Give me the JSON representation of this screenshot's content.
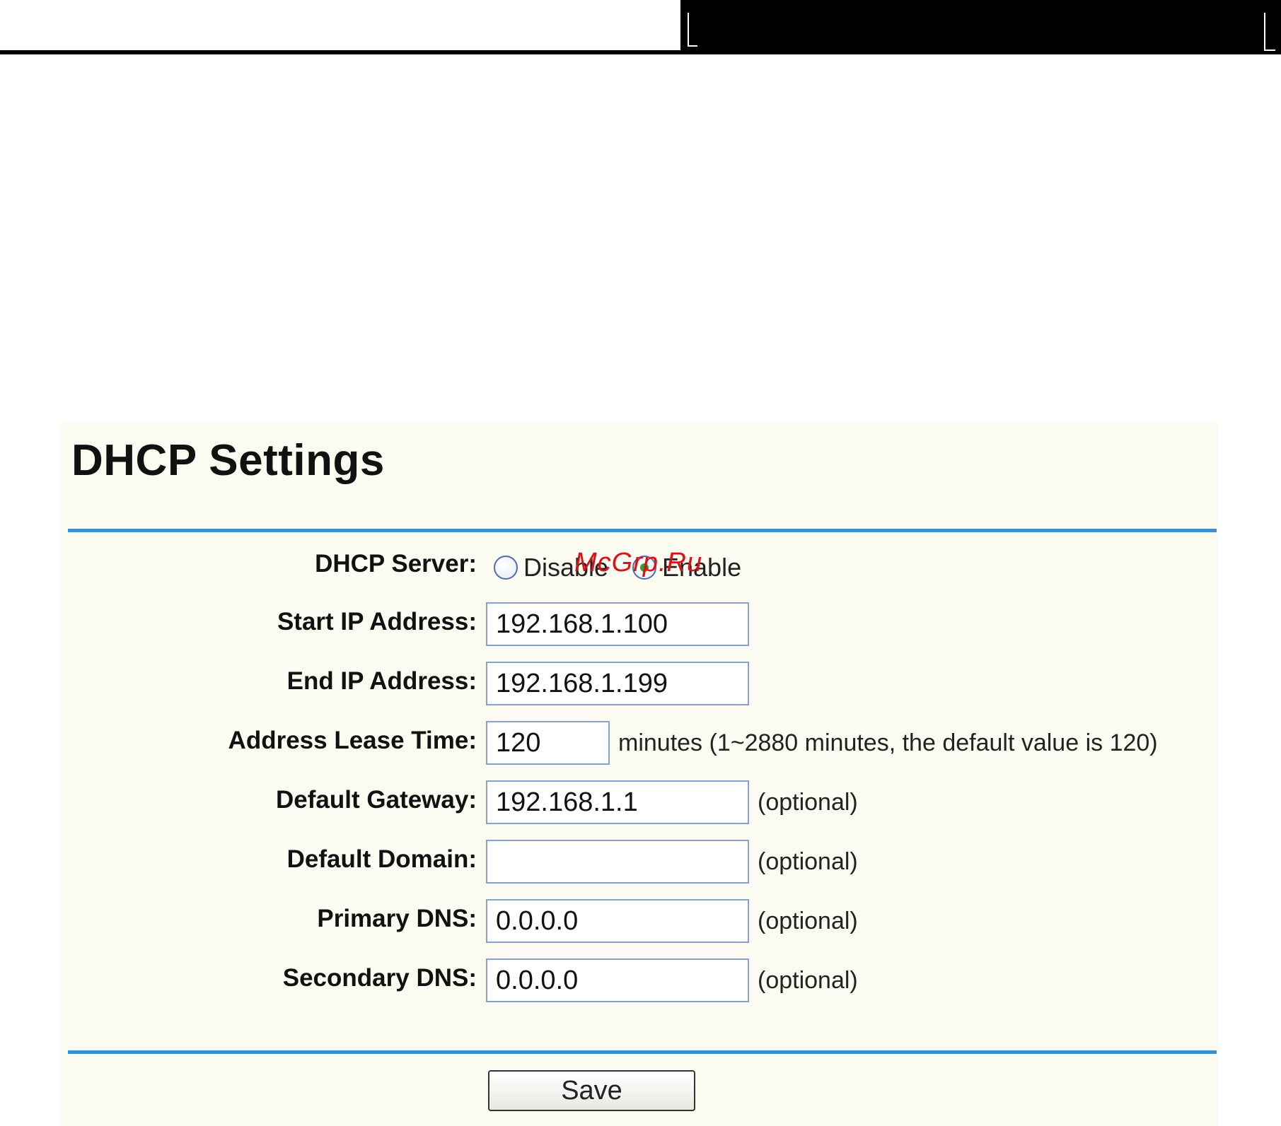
{
  "page": {
    "title": "DHCP Settings",
    "watermark": "McGrp.Ru"
  },
  "form": {
    "dhcp_server": {
      "label": "DHCP Server:",
      "options": [
        "Disable",
        "Enable"
      ],
      "selected": "Enable"
    },
    "start_ip": {
      "label": "Start IP Address:",
      "value": "192.168.1.100"
    },
    "end_ip": {
      "label": "End IP Address:",
      "value": "192.168.1.199"
    },
    "lease_time": {
      "label": "Address Lease Time:",
      "value": "120",
      "hint": "minutes (1~2880 minutes, the default value is 120)"
    },
    "gateway": {
      "label": "Default Gateway:",
      "value": "192.168.1.1",
      "hint": "(optional)"
    },
    "domain": {
      "label": "Default Domain:",
      "value": "",
      "hint": "(optional)"
    },
    "primary_dns": {
      "label": "Primary DNS:",
      "value": "0.0.0.0",
      "hint": "(optional)"
    },
    "secondary_dns": {
      "label": "Secondary DNS:",
      "value": "0.0.0.0",
      "hint": "(optional)"
    },
    "save_label": "Save"
  },
  "colors": {
    "panel_background": "#fbfbf2",
    "rule": "#3b8fd0",
    "input_border": "#8aa0c8",
    "radio_selected": "#2ea12e"
  }
}
